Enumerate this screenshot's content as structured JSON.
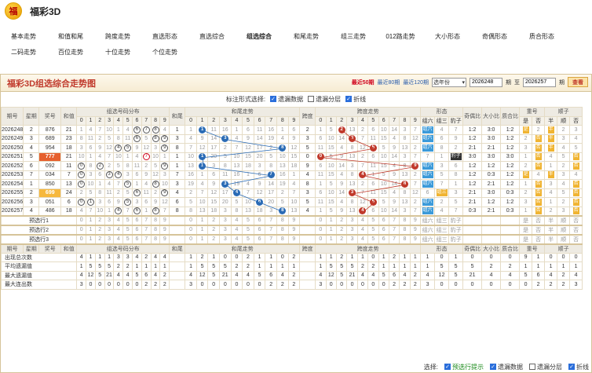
{
  "app": {
    "logo": "福",
    "title": "福彩3D"
  },
  "nav": [
    [
      "基本走势",
      "和值和尾",
      "跨度走势",
      "直选形态",
      "直选综合",
      "组选综合",
      "和尾走势",
      "组三走势",
      "012路走势",
      "大小形态",
      "奇偶形态",
      "质合形态"
    ],
    [
      "二码走势",
      "百位走势",
      "十位走势",
      "个位走势"
    ]
  ],
  "nav_active": "组选综合",
  "panel": {
    "title": "福彩3D组选综合走势图",
    "links": [
      "最近50期",
      "最近80期",
      "最近120期"
    ],
    "select": "选年份",
    "from": "2026248",
    "to": "2026257",
    "unit": "期",
    "sep": "至",
    "btn": "查看"
  },
  "tools": {
    "label": "标注形式选择:",
    "opts": [
      {
        "t": "遗漏数据",
        "on": true
      },
      {
        "t": "遗漏分层",
        "on": false
      },
      {
        "t": "折线",
        "on": true
      }
    ]
  },
  "headers": {
    "period": "期号",
    "week": "星期",
    "prize": "奖号",
    "sum": "和值",
    "dist": "组选号码分布",
    "tail": "和尾",
    "tailtrend": "和尾走势",
    "span": "跨度",
    "spantrend": "跨度走势",
    "form": "形态",
    "form_cols": [
      "组六",
      "组三",
      "豹子"
    ],
    "oe": "奇偶比",
    "bs": "大小比",
    "pc": "质合比",
    "rep": "重号",
    "rep_cols": [
      "是",
      "否"
    ],
    "ord": "顺子",
    "ord_cols": [
      "半",
      "顺",
      "否"
    ]
  },
  "rows": [
    {
      "p": "2026248",
      "w": "2",
      "n": "876",
      "s": "21",
      "t": "1",
      "k": "2",
      "f": "组六",
      "oe": "1:2",
      "bs": "3:0",
      "pc": "1:2",
      "rep": "是",
      "ord": "半"
    },
    {
      "p": "2026249",
      "w": "3",
      "n": "689",
      "s": "23",
      "t": "3",
      "k": "3",
      "f": "组六",
      "oe": "1:2",
      "bs": "3:0",
      "pc": "1:2",
      "rep": "否",
      "ord": "半"
    },
    {
      "p": "2026250",
      "w": "4",
      "n": "954",
      "s": "18",
      "t": "8",
      "k": "5",
      "f": "组六",
      "oe": "2:1",
      "bs": "2:1",
      "pc": "1:2",
      "rep": "否",
      "ord": "半"
    },
    {
      "p": "2026251",
      "w": "5",
      "n": "777",
      "s": "21",
      "t": "1",
      "k": "0",
      "f": "豹子",
      "oe": "3:0",
      "bs": "3:0",
      "pc": "3:0",
      "rep": "否",
      "ord": "否"
    },
    {
      "p": "2026252",
      "w": "6",
      "n": "092",
      "s": "11",
      "t": "1",
      "k": "9",
      "f": "组六",
      "oe": "1:2",
      "bs": "1:2",
      "pc": "1:2",
      "rep": "否",
      "ord": "否"
    },
    {
      "p": "2026253",
      "w": "7",
      "n": "034",
      "s": "7",
      "t": "7",
      "k": "4",
      "f": "组六",
      "oe": "1:2",
      "bs": "0:3",
      "pc": "1:2",
      "rep": "是",
      "ord": "半"
    },
    {
      "p": "2026254",
      "w": "1",
      "n": "850",
      "s": "13",
      "t": "3",
      "k": "8",
      "f": "组六",
      "oe": "1:2",
      "bs": "2:1",
      "pc": "1:2",
      "rep": "否",
      "ord": "否"
    },
    {
      "p": "2026255",
      "w": "2",
      "n": "699",
      "s": "24",
      "t": "4",
      "k": "3",
      "f": "组三",
      "oe": "2:1",
      "bs": "3:0",
      "pc": "0:3",
      "rep": "否",
      "ord": "否"
    },
    {
      "p": "2026256",
      "w": "3",
      "n": "051",
      "s": "6",
      "t": "6",
      "k": "5",
      "f": "组六",
      "oe": "2:1",
      "bs": "1:2",
      "pc": "1:2",
      "rep": "否",
      "ord": "否"
    },
    {
      "p": "2026257",
      "w": "4",
      "n": "486",
      "s": "18",
      "t": "8",
      "k": "4",
      "f": "组六",
      "oe": "0:3",
      "bs": "2:1",
      "pc": "0:3",
      "rep": "否",
      "ord": "否"
    }
  ],
  "preview": [
    "预选行1",
    "预选行2",
    "预选行3"
  ],
  "stats": [
    {
      "l": "出现总次数",
      "v": [
        "4",
        "1",
        "1",
        "1",
        "3",
        "3",
        "4",
        "2",
        "4",
        "4",
        "1",
        "2",
        "1",
        "0",
        "0",
        "2",
        "1",
        "1",
        "0",
        "2",
        "1",
        "1",
        "2",
        "1",
        "1",
        "0",
        "1",
        "2",
        "1",
        "1",
        "1",
        "0",
        "1",
        "0",
        "0",
        "0",
        "9",
        "1",
        "0",
        "0",
        "0",
        "5",
        "5",
        "4",
        "1",
        "1",
        "5",
        "5",
        "4",
        "1",
        "1"
      ]
    },
    {
      "l": "平均遗漏值",
      "v": [
        "1",
        "5",
        "5",
        "5",
        "2",
        "2",
        "1",
        "1",
        "1",
        "1"
      ]
    },
    {
      "l": "最大遗漏值",
      "v": [
        "4",
        "12",
        "5",
        "21",
        "4",
        "4",
        "5",
        "6",
        "4",
        "2"
      ]
    },
    {
      "l": "最大连出数",
      "v": [
        "3",
        "0",
        "0",
        "0",
        "0",
        "0",
        "0",
        "2",
        "2",
        "2"
      ]
    }
  ],
  "bottom": {
    "label": "选择:",
    "opts": [
      {
        "t": "预选行提示",
        "on": true,
        "green": true
      },
      {
        "t": "遗漏数据",
        "on": true
      },
      {
        "t": "遗漏分层",
        "on": false
      },
      {
        "t": "折线",
        "on": true
      }
    ]
  }
}
